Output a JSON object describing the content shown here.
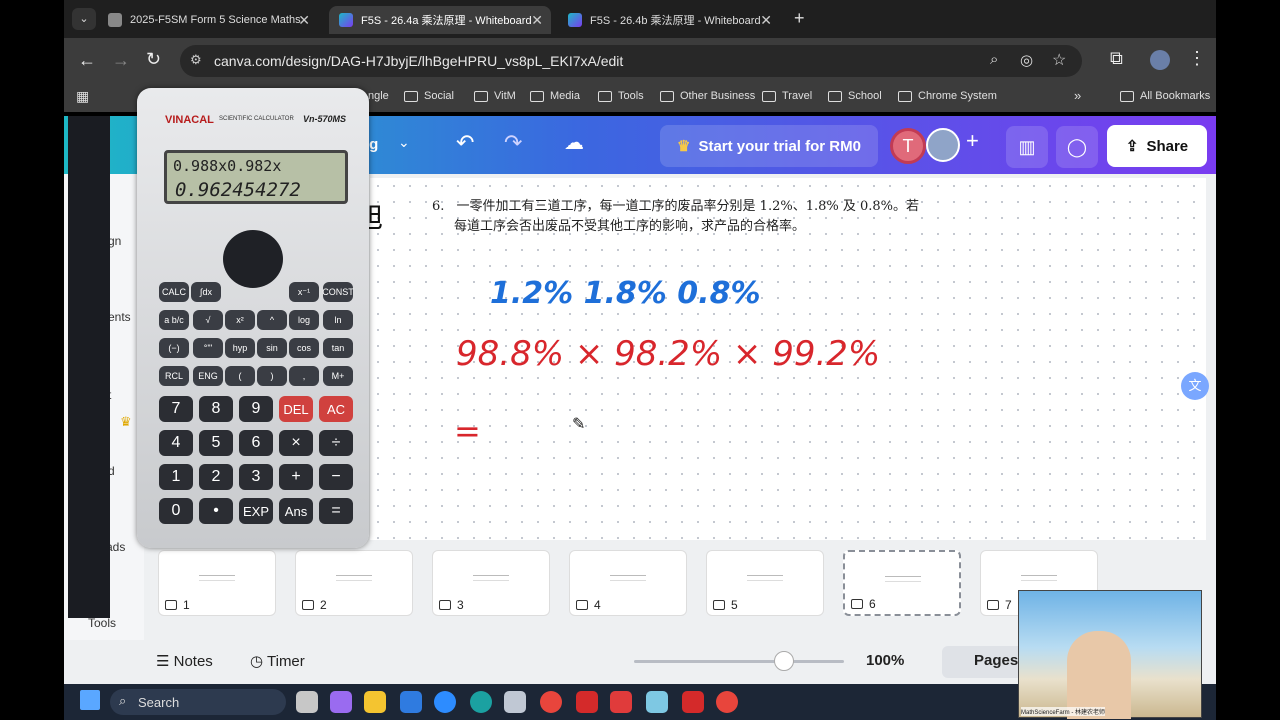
{
  "tabs": [
    {
      "label": "2025-F5SM Form 5 Science Maths",
      "active": false
    },
    {
      "label": "F5S - 26.4a 乘法原理 - Whiteboard",
      "active": true
    },
    {
      "label": "F5S - 26.4b 乘法原理 - Whiteboard",
      "active": false
    }
  ],
  "omnibox": {
    "url": "canva.com/design/DAG-H7JbyjE/lhBgeHPRU_vs8pL_EKI7xA/edit"
  },
  "bookmarks": [
    "ngle",
    "Social",
    "VitM",
    "Media",
    "Tools",
    "Other Business",
    "Travel",
    "School",
    "Chrome System",
    "All Bookmarks"
  ],
  "canva": {
    "doc_title_fragment": "ng",
    "trial_label": "Start your trial for RM0",
    "share_label": "Share",
    "avatar_letter": "T",
    "side_fragments": [
      "gn",
      "ents",
      "t",
      "d",
      "ads",
      "Tools"
    ]
  },
  "question": {
    "title_fragment": "旭",
    "number": "6.",
    "line1": "一零件加工有三道工序，每一道工序的废品率分别是 1.2%、1.8% 及 0.8%。若",
    "line2": "每道工序会否出废品不受其他工序的影响，求产品的合格率。"
  },
  "handwriting": {
    "rates": "1.2%  1.8%  0.8%",
    "product": "98.8% × 98.2% × 99.2%",
    "equals": "="
  },
  "calculator": {
    "brand": "VINACAL",
    "subtitle": "SCIENTIFIC CALCULATOR",
    "model": "Vn-570MS",
    "input": "0.988x0.982x",
    "result": "0.962454272",
    "keys_row1": [
      "CALC",
      "∫dx",
      "x⁻¹",
      "CONST"
    ],
    "keys_row2": [
      "a b/c",
      "√",
      "x²",
      "^",
      "log",
      "ln"
    ],
    "keys_row3": [
      "(−)",
      "°'\"",
      "hyp",
      "sin",
      "cos",
      "tan"
    ],
    "keys_row4": [
      "RCL",
      "ENG",
      "(",
      ")",
      ",",
      "M+"
    ],
    "digits": [
      "7",
      "8",
      "9",
      "DEL",
      "AC",
      "4",
      "5",
      "6",
      "×",
      "÷",
      "1",
      "2",
      "3",
      "+",
      "−",
      "0",
      "•",
      "EXP",
      "Ans",
      "="
    ]
  },
  "pages": [
    "1",
    "2",
    "3",
    "4",
    "5",
    "6",
    "7"
  ],
  "footer": {
    "notes": "Notes",
    "timer": "Timer",
    "zoom": "100%",
    "pages": "Pages"
  },
  "taskbar": {
    "search": "Search"
  },
  "webcam": {
    "caption": "MathScienceFarm - 林建农老师"
  }
}
